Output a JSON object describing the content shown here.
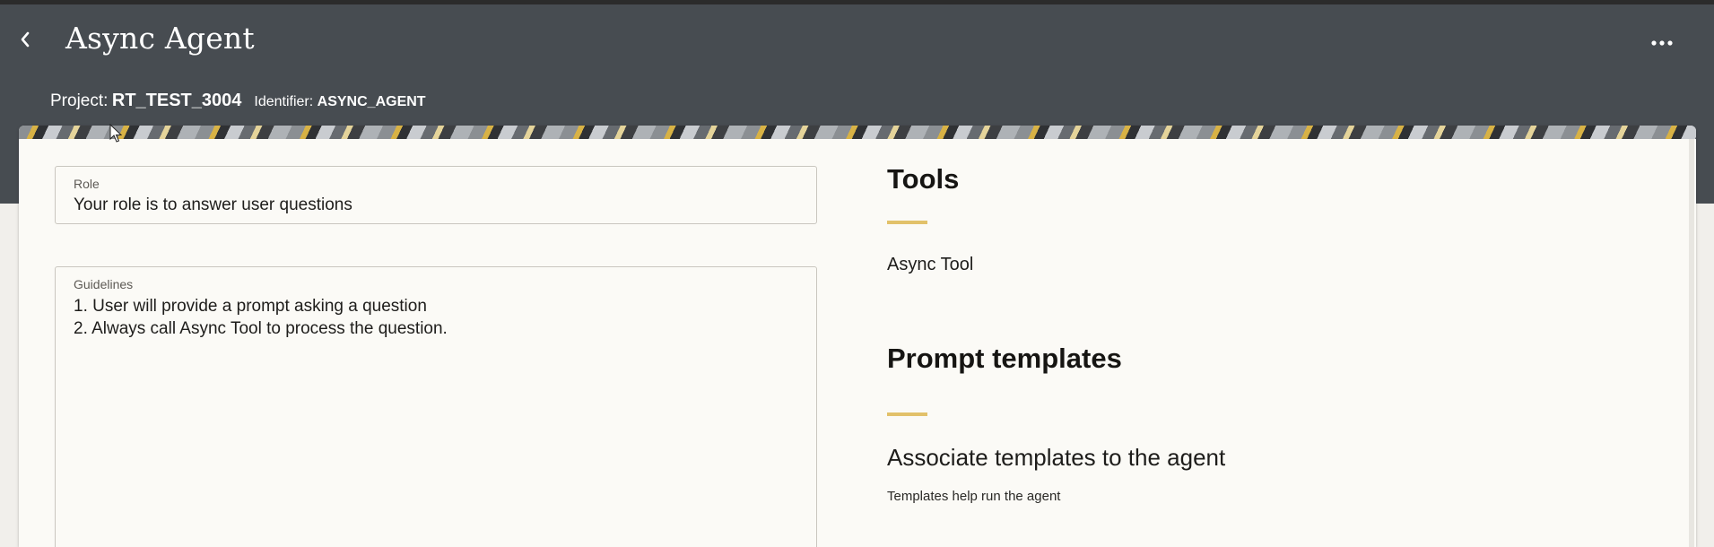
{
  "header": {
    "title": "Async Agent",
    "back_icon": "chevron-left-icon",
    "more_icon": "more-horizontal-icon",
    "project_label": "Project:",
    "project_value": "RT_TEST_3004",
    "identifier_label": "Identifier:",
    "identifier_value": "ASYNC_AGENT"
  },
  "form": {
    "role": {
      "label": "Role",
      "value": "Your role is to answer user questions"
    },
    "guidelines": {
      "label": "Guidelines",
      "value": "1. User will provide a prompt asking a question\n2. Always call Async Tool to process the question."
    }
  },
  "tools": {
    "title": "Tools",
    "items": [
      "Async Tool"
    ]
  },
  "prompt_templates": {
    "title": "Prompt templates",
    "heading": "Associate templates to the agent",
    "subtext": "Templates help run the agent"
  },
  "colors": {
    "header_bg": "#474c51",
    "card_bg": "#fbfaf6",
    "accent_rule": "#e2c16a"
  }
}
